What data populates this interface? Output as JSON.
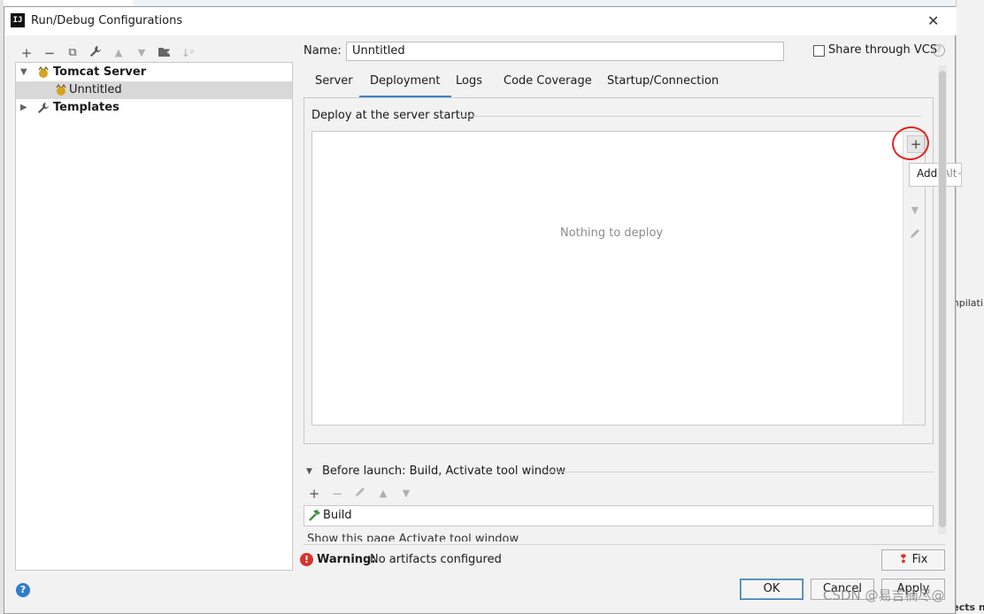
{
  "window": {
    "title": "Run/Debug Configurations",
    "app_icon": "IJ"
  },
  "background": {
    "right_text_1": "mpilati",
    "right_text_2": "Maven projects n"
  },
  "tree": {
    "items": [
      {
        "label": "Tomcat Server",
        "icon": "tomcat-icon"
      },
      {
        "label": "Unntitled",
        "icon": "tomcat-icon"
      },
      {
        "label": "Templates",
        "icon": "wrench-icon"
      }
    ]
  },
  "config": {
    "name_label": "Name:",
    "name_value": "Unntitled",
    "share_label": "Share through VCS"
  },
  "tabs": [
    {
      "label": "Server"
    },
    {
      "label": "Deployment"
    },
    {
      "label": "Logs"
    },
    {
      "label": "Code Coverage"
    },
    {
      "label": "Startup/Connection"
    }
  ],
  "deployment": {
    "section_title": "Deploy at the server startup",
    "empty_text": "Nothing to deploy",
    "tooltip_label": "Add",
    "tooltip_shortcut": "Alt+Insert"
  },
  "before_launch": {
    "title": "Before launch: Build, Activate tool window",
    "items": [
      {
        "label": "Build"
      }
    ],
    "partial_options": "Show this page    Activate tool window"
  },
  "status": {
    "warning_label": "Warning:",
    "warning_text": "No artifacts configured",
    "fix_label": "Fix"
  },
  "buttons": {
    "ok": "OK",
    "cancel": "Cancel",
    "apply": "Apply"
  },
  "watermark": "CSDN @易吉楠尽@",
  "colors": {
    "accent": "#4083c9",
    "warning": "#d9322b",
    "annotation": "#e2231a"
  }
}
